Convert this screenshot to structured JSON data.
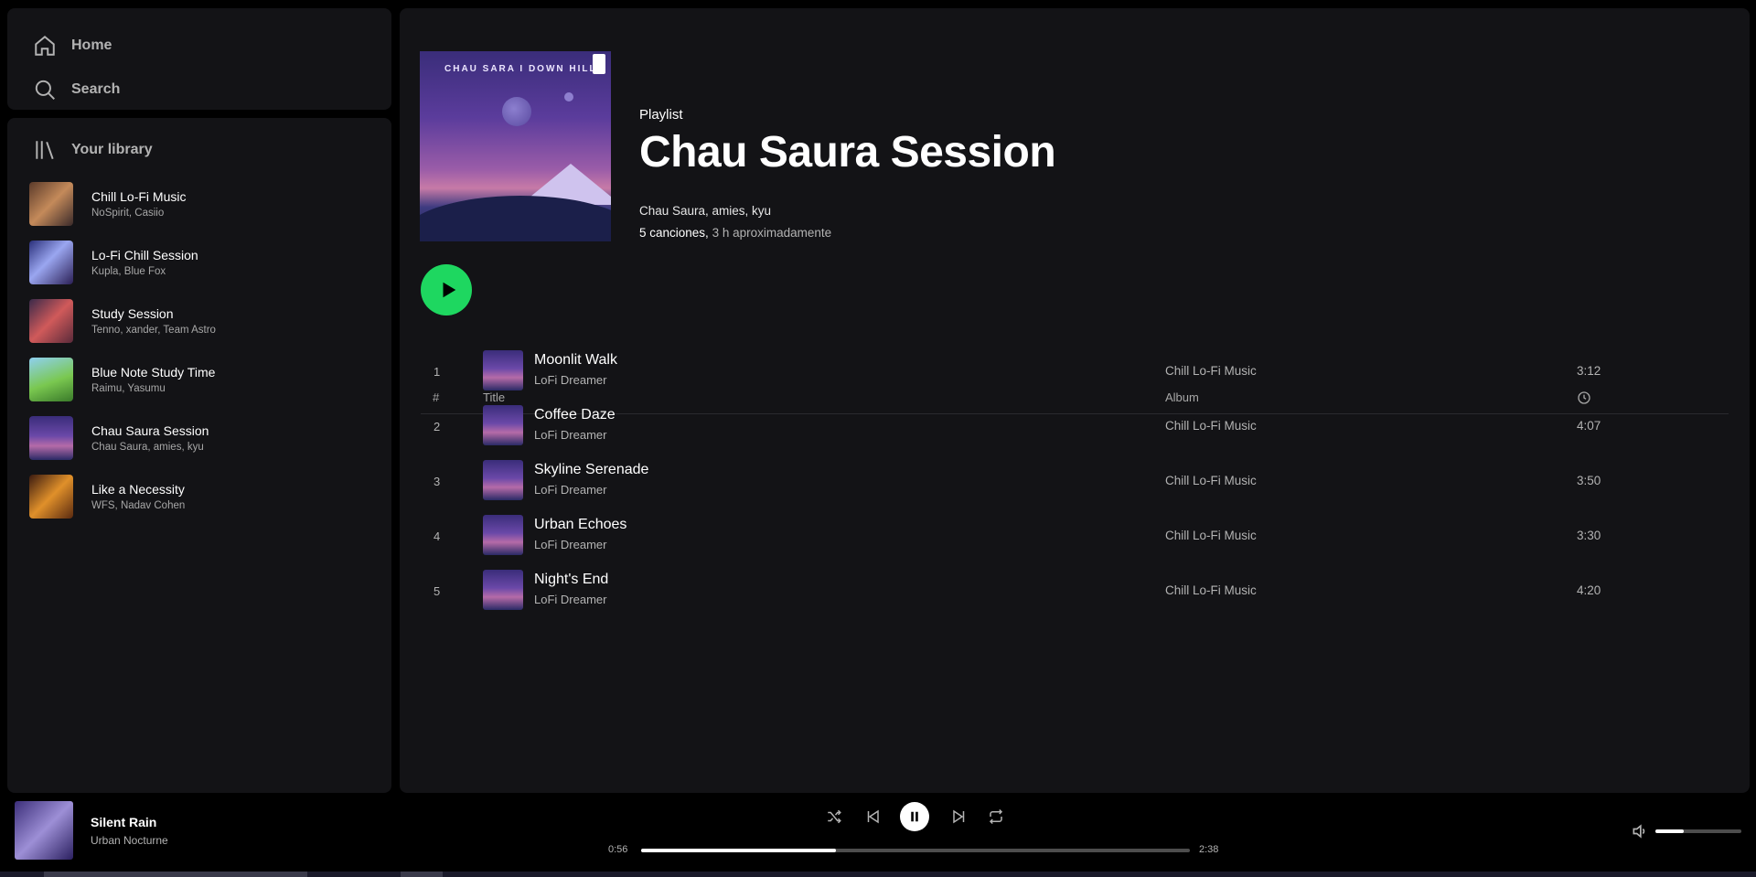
{
  "nav": {
    "home_label": "Home",
    "search_label": "Search"
  },
  "library": {
    "header": "Your library",
    "items": [
      {
        "title": "Chill Lo-Fi Music",
        "subtitle": "NoSpirit, Casiio"
      },
      {
        "title": "Lo-Fi Chill Session",
        "subtitle": "Kupla, Blue Fox"
      },
      {
        "title": "Study Session",
        "subtitle": "Tenno, xander, Team Astro"
      },
      {
        "title": "Blue Note Study Time",
        "subtitle": "Raimu, Yasumu"
      },
      {
        "title": "Chau Saura Session",
        "subtitle": "Chau Saura, amies, kyu"
      },
      {
        "title": "Like a Necessity",
        "subtitle": "WFS, Nadav Cohen"
      }
    ]
  },
  "playlist": {
    "type_label": "Playlist",
    "title": "Chau Saura Session",
    "artists": "Chau Saura, amies, kyu",
    "song_count": "5 canciones,",
    "duration": "3 h aproximadamente",
    "cover_text": "CHAU SARA  I DOWN HILL"
  },
  "table": {
    "col_num": "#",
    "col_title": "Title",
    "col_album": "Album",
    "tracks": [
      {
        "num": "1",
        "title": "Moonlit Walk",
        "artist": "LoFi Dreamer",
        "album": "Chill Lo-Fi Music",
        "duration": "3:12"
      },
      {
        "num": "2",
        "title": "Coffee Daze",
        "artist": "LoFi Dreamer",
        "album": "Chill Lo-Fi Music",
        "duration": "4:07"
      },
      {
        "num": "3",
        "title": "Skyline Serenade",
        "artist": "LoFi Dreamer",
        "album": "Chill Lo-Fi Music",
        "duration": "3:50"
      },
      {
        "num": "4",
        "title": "Urban Echoes",
        "artist": "LoFi Dreamer",
        "album": "Chill Lo-Fi Music",
        "duration": "3:30"
      },
      {
        "num": "5",
        "title": "Night's End",
        "artist": "LoFi Dreamer",
        "album": "Chill Lo-Fi Music",
        "duration": "4:20"
      }
    ]
  },
  "player": {
    "now_playing_title": "Silent Rain",
    "now_playing_artist": "Urban Nocturne",
    "time_current": "0:56",
    "time_total": "2:38",
    "progress_fraction": 0.355,
    "volume_fraction": 0.33,
    "icons": [
      "shuffle-icon",
      "previous-icon",
      "pause-icon",
      "next-icon",
      "repeat-icon",
      "volume-icon"
    ]
  },
  "colors": {
    "accent": "#1ed760",
    "panel": "#131316",
    "background": "#000000",
    "text_muted": "#b3b3b3"
  }
}
